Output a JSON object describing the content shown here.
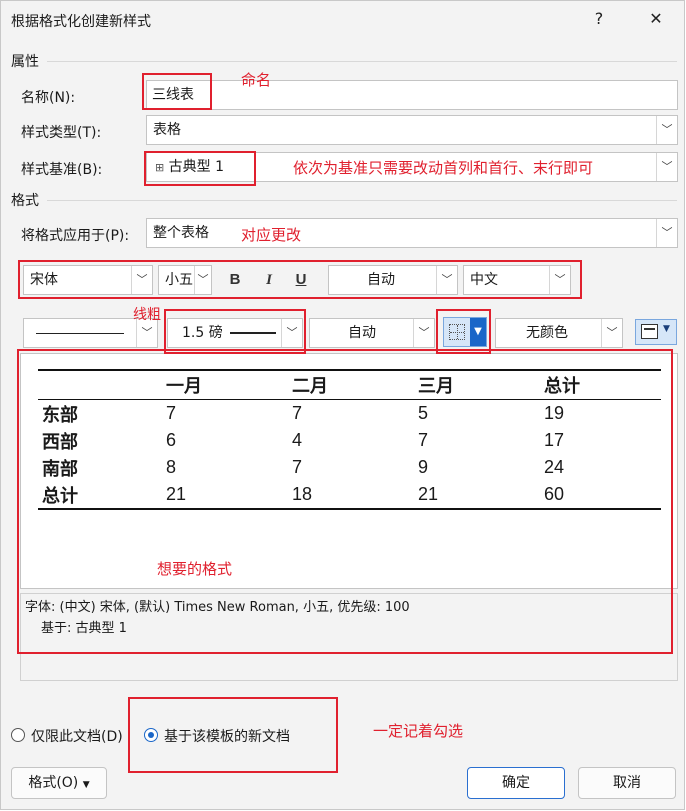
{
  "window": {
    "title": "根据格式化创建新样式",
    "help": "?",
    "close": "✕"
  },
  "properties": {
    "group_label": "属性",
    "name_label": "名称(N):",
    "name_value": "三线表",
    "type_label": "样式类型(T):",
    "type_value": "表格",
    "base_label": "样式基准(B):",
    "base_value": "古典型 1",
    "base_icon": "table-icon"
  },
  "format": {
    "group_label": "格式",
    "apply_label": "将格式应用于(P):",
    "apply_value": "整个表格",
    "font": "宋体",
    "size": "小五",
    "bold": "B",
    "italic": "I",
    "underline": "U",
    "color": "自动",
    "script": "中文",
    "border_style": "",
    "border_width": "1.5 磅",
    "border_color": "自动",
    "shading": "无颜色",
    "border_icon": "border-grid-icon",
    "properties_icon": "table-properties-icon"
  },
  "preview": {
    "headers": [
      "",
      "一月",
      "二月",
      "三月",
      "总计"
    ],
    "rows": [
      [
        "东部",
        "7",
        "7",
        "5",
        "19"
      ],
      [
        "西部",
        "6",
        "4",
        "7",
        "17"
      ],
      [
        "南部",
        "8",
        "7",
        "9",
        "24"
      ],
      [
        "总计",
        "21",
        "18",
        "21",
        "60"
      ]
    ]
  },
  "description": {
    "line1": "字体: (中文) 宋体, (默认) Times New Roman, 小五, 优先级: 100",
    "line2": "基于: 古典型 1"
  },
  "options": {
    "only_this_doc": "仅限此文档(D)",
    "new_docs": "基于该模板的新文档",
    "selected": "new_docs"
  },
  "buttons": {
    "format": "格式(O)",
    "ok": "确定",
    "cancel": "取消"
  },
  "annotations": {
    "name_note": "命名",
    "base_note": "依次为基准只需要改动首列和首行、末行即可",
    "apply_note": "对应更改",
    "line_note": "线粗",
    "style_note": "想要的格式",
    "remember_note": "一定记着勾选"
  },
  "colors": {
    "annotation": "#e0202e",
    "accent": "#1a66c8"
  }
}
